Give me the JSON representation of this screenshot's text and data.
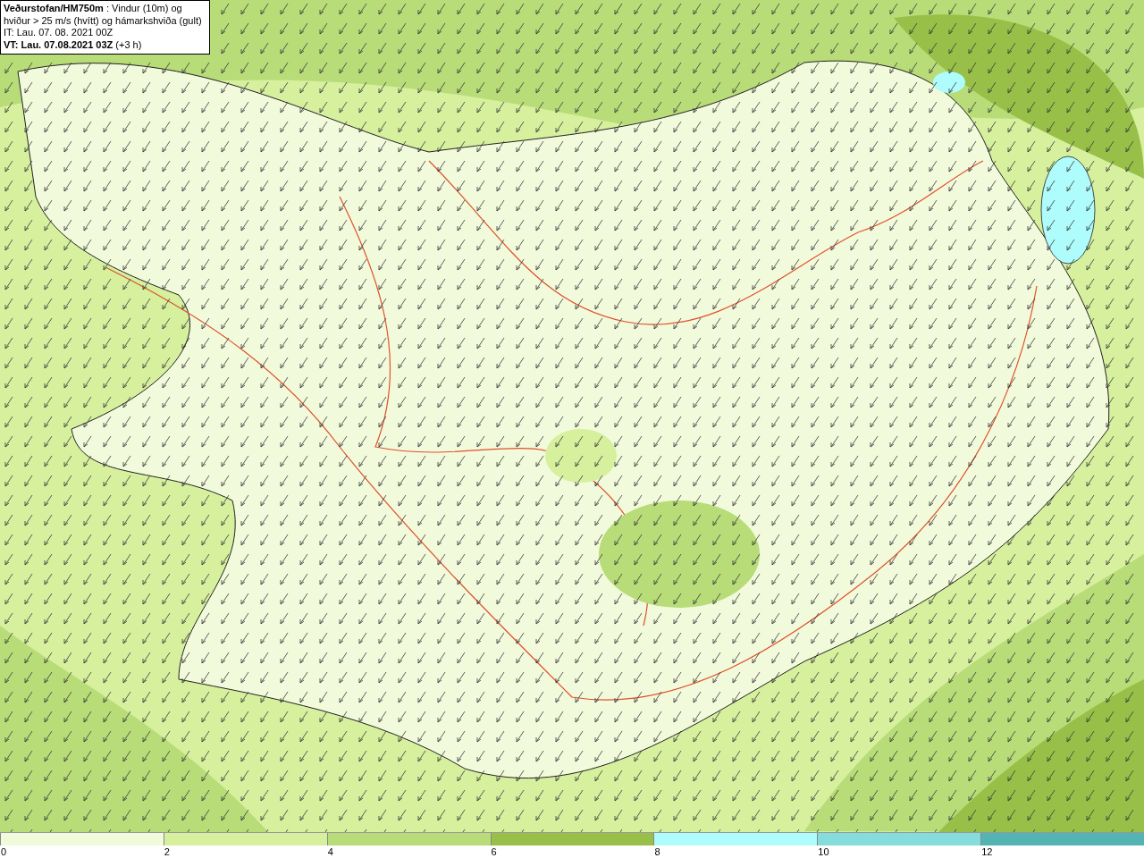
{
  "header": {
    "title": "**Veðurstofan/HM750m** : Vindur (10m) og hviður > 25 m/s (hvítt) og hámarkshviða (gult)",
    "issue_time": "IT: Lau. 07. 08. 2021 00Z",
    "valid_time": "**VT: Lau. 07.08.2021 03Z** (+3 h)"
  },
  "legend": {
    "segments": [
      {
        "color": "#f2fadc",
        "label": "0"
      },
      {
        "color": "#d6f09e",
        "label": "2"
      },
      {
        "color": "#b8dc78",
        "label": "4"
      },
      {
        "color": "#98c048",
        "label": "6"
      },
      {
        "color": "#aefcfc",
        "label": "8"
      },
      {
        "color": "#84dcdc",
        "label": "10"
      },
      {
        "color": "#54b4b4",
        "label": "12"
      }
    ]
  }
}
